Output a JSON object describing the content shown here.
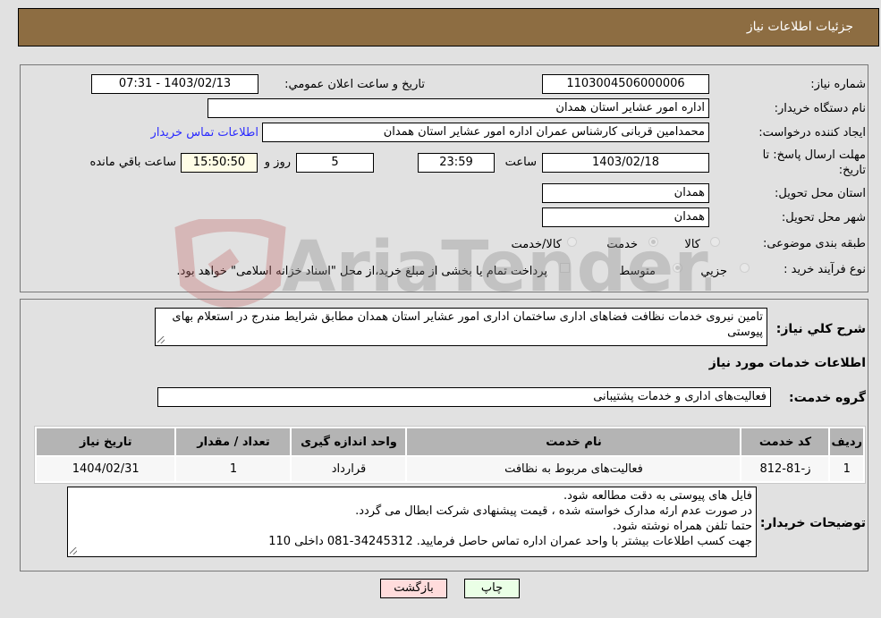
{
  "header": {
    "title": "جزئیات اطلاعات نیاز"
  },
  "form": {
    "need_number_label": "شماره نیاز:",
    "need_number": "1103004506000006",
    "announce_label": "تاریخ و ساعت اعلان عمومي:",
    "announce_value": "1403/02/13 - 07:31",
    "buyer_org_label": "نام دستگاه خریدار:",
    "buyer_org": "اداره امور عشایر استان همدان",
    "creator_label": "ایجاد کننده درخواست:",
    "creator": "محمدامین قربانی کارشناس عمران اداره امور عشایر استان همدان",
    "contact_link": "اطلاعات تماس خریدار",
    "deadline_label_line1": "مهلت ارسال پاسخ: تا",
    "deadline_label_line2": "تاریخ:",
    "deadline_date": "1403/02/18",
    "time_label": "ساعت",
    "deadline_time": "23:59",
    "days_value": "5",
    "days_label": "روز و",
    "remaining_time": "15:50:50",
    "remaining_label": "ساعت باقي مانده",
    "province_label": "استان محل تحویل:",
    "province": "همدان",
    "city_label": "شهر محل تحویل:",
    "city": "همدان",
    "category_label": "طبقه بندی موضوعی:",
    "category_options": [
      "کالا",
      "خدمت",
      "کالا/خدمت"
    ],
    "category_selected": "خدمت",
    "process_label": "نوع فرآیند خرید :",
    "process_options": [
      "جزيي",
      "متوسط"
    ],
    "process_selected": "متوسط",
    "treasury_note": "پرداخت تمام یا بخشی از مبلغ خرید،از محل \"اسناد خزانه اسلامی\" خواهد بود."
  },
  "description": {
    "label": "شرح کلي نیاز:",
    "text": "تامین نیروی خدمات نظافت فضاهای اداری ساختمان اداری امور عشایر استان همدان مطابق شرایط مندرج در استعلام بهای پیوستی"
  },
  "services": {
    "section_title": "اطلاعات خدمات مورد نیاز",
    "group_label": "گروه خدمت:",
    "group_value": "فعالیت‌های اداری و خدمات پشتیبانی",
    "table": {
      "headers": [
        "ردیف",
        "کد خدمت",
        "نام خدمت",
        "واحد اندازه گیری",
        "تعداد / مقدار",
        "تاریخ نیاز"
      ],
      "rows": [
        [
          "1",
          "ز-81-812",
          "فعالیت‌های مربوط به نظافت",
          "قرارداد",
          "1",
          "1404/02/31"
        ]
      ]
    }
  },
  "buyer_notes": {
    "label": "توضیحات خریدار:",
    "lines": [
      "فایل های پیوستی به دقت مطالعه شود.",
      "در صورت عدم ارئه مدارک خواسته شده ، قیمت پیشنهادی شرکت ابطال می گردد.",
      "حتما تلفن همراه نوشته شود.",
      "جهت کسب اطلاعات بیشتر با واحد عمران اداره تماس حاصل فرمایید. 34245312-081  داخلی 110"
    ]
  },
  "buttons": {
    "print": "چاپ",
    "back": "بازگشت"
  },
  "watermark": {
    "text": "AriaTender.neT"
  }
}
